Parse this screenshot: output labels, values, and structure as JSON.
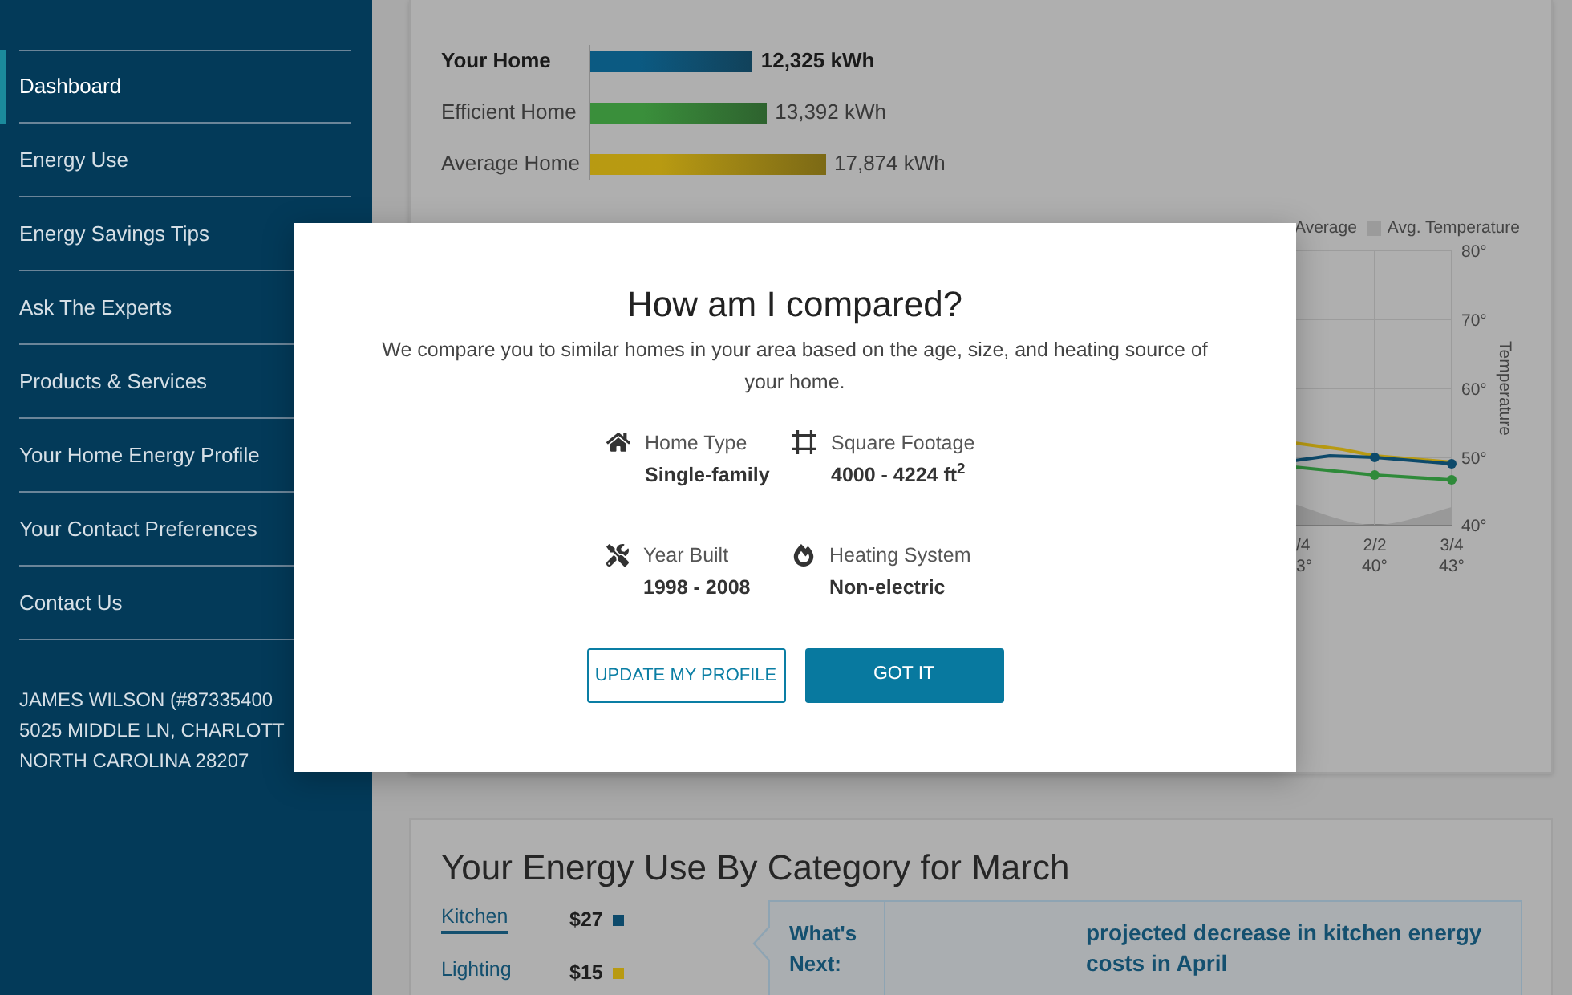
{
  "sidebar": {
    "items": [
      {
        "label": "Dashboard",
        "selected": true
      },
      {
        "label": "Energy Use",
        "selected": false
      },
      {
        "label": "Energy Savings Tips",
        "selected": false
      },
      {
        "label": "Ask The Experts",
        "selected": false
      },
      {
        "label": "Products & Services",
        "selected": false
      },
      {
        "label": "Your Home Energy Profile",
        "selected": false
      },
      {
        "label": "Your Contact Preferences",
        "selected": false
      },
      {
        "label": "Contact Us",
        "selected": false
      }
    ],
    "account_lines": [
      "JAMES WILSON (#87335400",
      "5025 MIDDLE LN, CHARLOTT",
      "NORTH CAROLINA 28207"
    ]
  },
  "usage_comparison": {
    "bars": [
      {
        "color": "#0b5a82",
        "emphasized": true
      },
      {
        "color": "#3a8f3b",
        "emphasized": false
      },
      {
        "color": "#b89a12",
        "emphasized": false
      }
    ],
    "chart_data": {
      "type": "bar",
      "orientation": "horizontal",
      "categories": [
        "Your Home",
        "Efficient Home",
        "Average Home"
      ],
      "values": [
        12325,
        13392,
        17874
      ],
      "value_labels": [
        "12,325 kWh",
        "13,392 kWh",
        "17,874 kWh"
      ]
    }
  },
  "usage_trend": {
    "legend": [
      {
        "label": "Average"
      },
      {
        "label": "Avg. Temperature",
        "color": "#9b9b9b"
      }
    ],
    "axis_title": "Temperature",
    "y_ticks": [
      "80°",
      "70°",
      "60°",
      "50°",
      "40°"
    ],
    "x_labels": [
      {
        "date": "/4",
        "temperature": "3°"
      },
      {
        "date": "2/2",
        "temperature": "40°"
      },
      {
        "date": "3/4",
        "temperature": "43°"
      }
    ]
  },
  "category_breakdown": {
    "title": "Your Energy Use By Category for March",
    "categories": [
      {
        "label": "Kitchen",
        "amount": "$27",
        "color": "#0d4a6b",
        "selected": true
      },
      {
        "label": "Lighting",
        "amount": "$15",
        "color": "#b89a12",
        "selected": false
      }
    ],
    "whats_next": {
      "label": "What's Next:",
      "message": "projected decrease in kitchen energy costs in April"
    }
  },
  "modal": {
    "title": "How am I compared?",
    "description": "We compare you to similar homes in your area based on the age, size, and heating source of your home.",
    "details": [
      {
        "kind": "home",
        "label": "Home Type",
        "value": "Single-family"
      },
      {
        "kind": "size",
        "label": "Square Footage",
        "value": "4000 - 4224 ft$^{2}$"
      },
      {
        "kind": "built",
        "label": "Year Built",
        "value": "1998 - 2008"
      },
      {
        "kind": "heating",
        "label": "Heating System",
        "value": "Non-electric"
      }
    ],
    "buttons": [
      {
        "kind": "outline",
        "label": "UPDATE MY PROFILE"
      },
      {
        "kind": "primary",
        "label": "GOT IT"
      }
    ]
  }
}
